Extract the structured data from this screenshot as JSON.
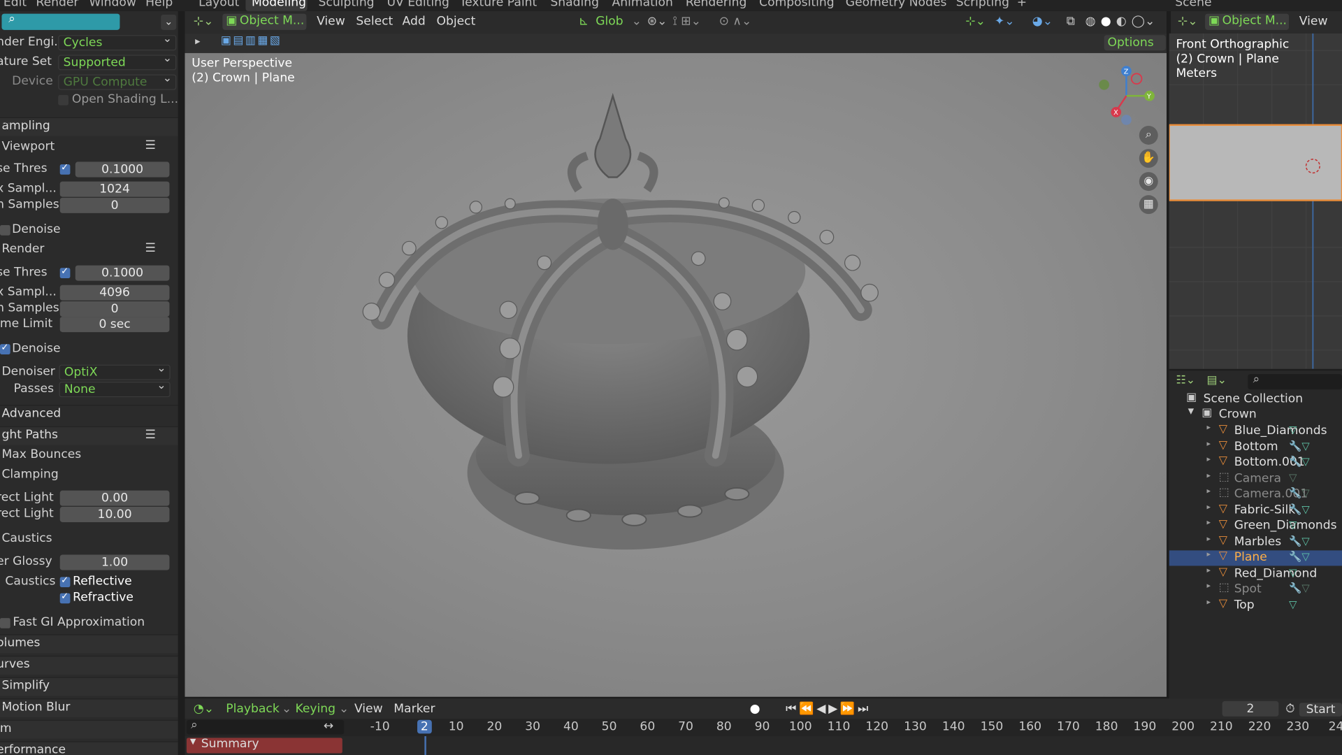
{
  "top_menu": [
    "Edit",
    "Render",
    "Window",
    "Help"
  ],
  "workspace_tabs": [
    "Layout",
    "Modeling",
    "Sculpting",
    "UV Editing",
    "Texture Paint",
    "Shading",
    "Animation",
    "Rendering",
    "Compositing",
    "Geometry Nodes",
    "Scripting"
  ],
  "workspace_add": "+",
  "scene_label": "Scene",
  "properties": {
    "render_engine_label": "nder Engi...",
    "render_engine": "Cycles",
    "feature_set_label": "ature Set",
    "feature_set": "Supported",
    "device_label": "Device",
    "device": "GPU Compute",
    "open_shading": "Open Shading L...",
    "sampling": "ampling",
    "viewport": "Viewport",
    "vp_noise_label": "se Thres",
    "vp_noise": "0.1000",
    "vp_max_label": "x Sampl...",
    "vp_max": "1024",
    "vp_min_label": "n Samples",
    "vp_min": "0",
    "vp_denoise": "Denoise",
    "render": "Render",
    "r_noise_label": "se Thres",
    "r_noise": "0.1000",
    "r_max_label": "x Sampl...",
    "r_max": "4096",
    "r_min_label": "n Samples",
    "r_min": "0",
    "time_limit_label": "ime Limit",
    "time_limit": "0 sec",
    "r_denoise": "Denoise",
    "denoiser_label": "Denoiser",
    "denoiser": "OptiX",
    "passes_label": "Passes",
    "passes": "None",
    "advanced": "Advanced",
    "light_paths": "ght Paths",
    "max_bounces": "Max Bounces",
    "clamping": "Clamping",
    "direct_label": "rect Light",
    "direct": "0.00",
    "indirect_label": "rect Light",
    "indirect": "10.00",
    "caustics": "Caustics",
    "filter_glossy_label": "er Glossy",
    "filter_glossy": "1.00",
    "caustics_label": "Caustics",
    "reflective": "Reflective",
    "refractive": "Refractive",
    "fast_gi": "Fast GI Approximation",
    "volumes": "olumes",
    "curves": "urves",
    "simplify": "Simplify",
    "motion_blur": "Motion Blur",
    "film": "lm",
    "performance": "erformance"
  },
  "viewport": {
    "mode": "Object M...",
    "menus": [
      "View",
      "Select",
      "Add",
      "Object"
    ],
    "transform": "Glob",
    "options": "Options",
    "info_line1": "User Perspective",
    "info_line2": "(2) Crown | Plane",
    "gizmo": {
      "z": "Z",
      "y": "Y",
      "x": "X"
    }
  },
  "right_view": {
    "mode": "Object M...",
    "view": "View",
    "line1": "Front Orthographic",
    "line2": "(2) Crown | Plane",
    "line3": "Meters"
  },
  "outliner": {
    "scene_collection": "Scene Collection",
    "collection": "Crown",
    "items": [
      {
        "name": "Blue_Diamonds",
        "type": "mesh"
      },
      {
        "name": "Bottom",
        "type": "mesh"
      },
      {
        "name": "Bottom.001",
        "type": "mesh"
      },
      {
        "name": "Camera",
        "type": "camera"
      },
      {
        "name": "Camera.001",
        "type": "camera"
      },
      {
        "name": "Fabric-Silk",
        "type": "mesh"
      },
      {
        "name": "Green_Diamonds",
        "type": "mesh"
      },
      {
        "name": "Marbles",
        "type": "mesh"
      },
      {
        "name": "Plane",
        "type": "mesh",
        "selected": true
      },
      {
        "name": "Red_Diamond",
        "type": "mesh"
      },
      {
        "name": "Spot",
        "type": "light"
      },
      {
        "name": "Top",
        "type": "mesh"
      }
    ]
  },
  "timeline": {
    "playback": "Playback",
    "keying": "Keying",
    "view": "View",
    "marker": "Marker",
    "current_frame": "2",
    "start_label": "Start",
    "ticks": [
      "-10",
      "2",
      "10",
      "20",
      "30",
      "40",
      "50",
      "60",
      "70",
      "80",
      "90",
      "100",
      "110",
      "120",
      "130",
      "140",
      "150",
      "160",
      "170",
      "180",
      "190",
      "200",
      "210",
      "220",
      "230",
      "24"
    ],
    "summary": "Summary"
  },
  "colors": {
    "accent": "#4772b3",
    "selected_row": "#334d80",
    "mesh_icon": "#e88d3a",
    "active_tab": "#3a3a3a"
  }
}
